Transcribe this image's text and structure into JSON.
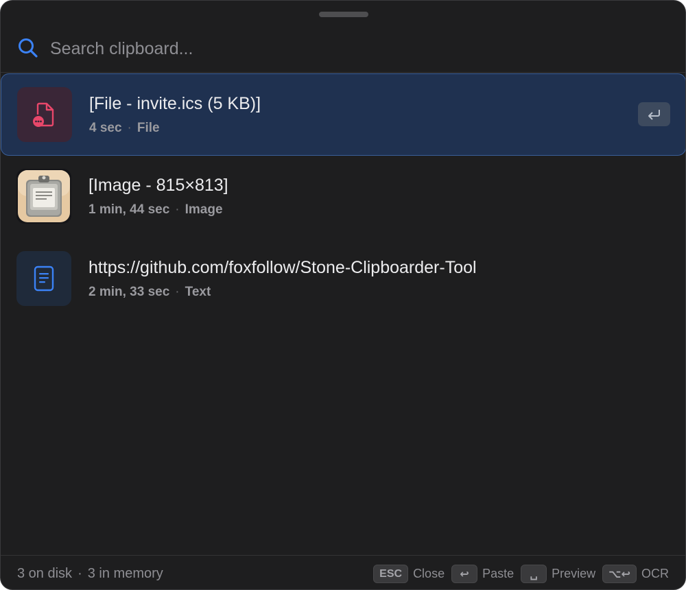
{
  "search": {
    "placeholder": "Search clipboard...",
    "value": ""
  },
  "items": [
    {
      "title": "[File - invite.ics (5 KB)]",
      "age": "4 sec",
      "kind": "File",
      "icon": "file-icon",
      "selected": true
    },
    {
      "title": "[Image - 815×813]",
      "age": "1 min, 44 sec",
      "kind": "Image",
      "icon": "clipboard-app-icon",
      "selected": false
    },
    {
      "title": "https://github.com/foxfollow/Stone-Clipboarder-Tool",
      "age": "2 min, 33 sec",
      "kind": "Text",
      "icon": "document-text-icon",
      "selected": false
    }
  ],
  "footer": {
    "disk": "3 on disk",
    "separator": "·",
    "memory": "3 in memory",
    "shortcuts": [
      {
        "key": "ESC",
        "label": "Close"
      },
      {
        "key": "↩",
        "label": "Paste"
      },
      {
        "key": "␣",
        "label": "Preview"
      },
      {
        "key": "⌥↩",
        "label": "OCR"
      }
    ]
  },
  "colors": {
    "background": "#1e1e1f",
    "selection": "#1f3150",
    "selection_border": "#3a5f9a",
    "accent": "#3b82f6",
    "file_icon": "#e8476a"
  },
  "row_dot": "·"
}
